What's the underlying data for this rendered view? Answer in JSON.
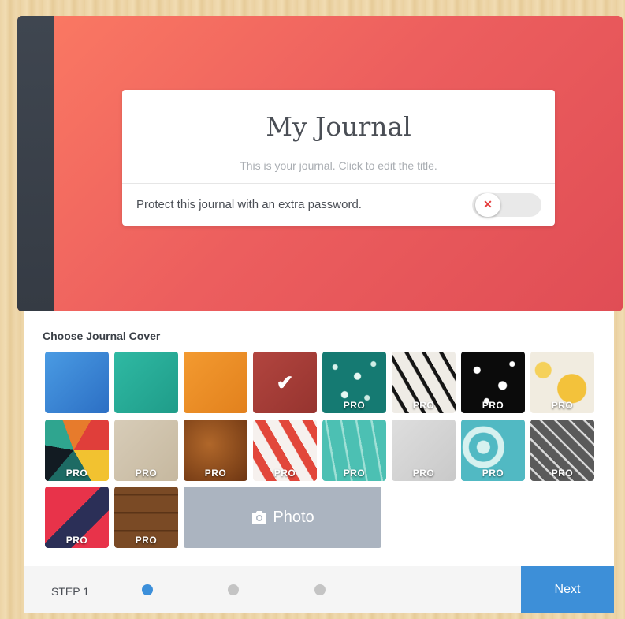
{
  "journal": {
    "title": "My Journal",
    "hint": "This is your journal. Click to edit the title.",
    "password_label": "Protect this journal with an extra password.",
    "password_toggle_glyph": "✕",
    "password_enabled": false,
    "cover_color": "#ec5e5e",
    "spine_color": "#3f4650"
  },
  "covers": {
    "heading": "Choose Journal Cover",
    "pro_label": "PRO",
    "check_glyph": "✔",
    "photo_label": "Photo",
    "photo_icon": "camera-icon",
    "tiles": [
      {
        "name": "solid-blue",
        "pro": false,
        "selected": false
      },
      {
        "name": "solid-teal",
        "pro": false,
        "selected": false
      },
      {
        "name": "solid-orange",
        "pro": false,
        "selected": false
      },
      {
        "name": "solid-red",
        "pro": false,
        "selected": true
      },
      {
        "name": "teal-dots-pattern",
        "pro": true,
        "selected": false
      },
      {
        "name": "black-leaf-pattern",
        "pro": true,
        "selected": false
      },
      {
        "name": "black-white-splatter",
        "pro": true,
        "selected": false
      },
      {
        "name": "yellow-flower-pattern",
        "pro": true,
        "selected": false
      },
      {
        "name": "geometric-triangles",
        "pro": true,
        "selected": false
      },
      {
        "name": "beige-paper-texture",
        "pro": true,
        "selected": false
      },
      {
        "name": "brown-leather-texture",
        "pro": true,
        "selected": false
      },
      {
        "name": "red-brush-strokes",
        "pro": true,
        "selected": false
      },
      {
        "name": "teal-lines-pattern",
        "pro": true,
        "selected": false
      },
      {
        "name": "grey-paper-texture",
        "pro": true,
        "selected": false
      },
      {
        "name": "teal-swirl-pattern",
        "pro": true,
        "selected": false
      },
      {
        "name": "grey-chevron-pattern",
        "pro": true,
        "selected": false
      },
      {
        "name": "red-fabric-texture",
        "pro": true,
        "selected": false
      },
      {
        "name": "wood-planks-texture",
        "pro": true,
        "selected": false
      }
    ]
  },
  "footer": {
    "step_label": "STEP 1",
    "steps_total": 3,
    "current_step": 1,
    "next_label": "Next",
    "accent_color": "#3d8fd8"
  }
}
